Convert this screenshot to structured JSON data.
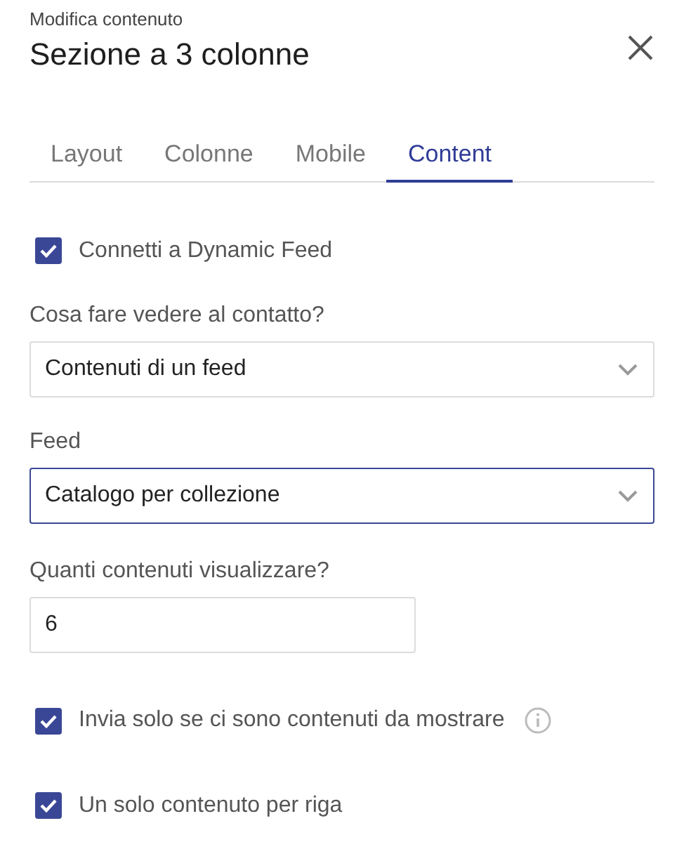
{
  "header": {
    "subtitle": "Modifica contenuto",
    "title": "Sezione a 3 colonne"
  },
  "tabs": [
    {
      "label": "Layout",
      "selected": false
    },
    {
      "label": "Colonne",
      "selected": false
    },
    {
      "label": "Mobile",
      "selected": false
    },
    {
      "label": "Content",
      "selected": true
    }
  ],
  "fields": [
    {
      "kind": "checkbox",
      "label": "Connetti a Dynamic Feed",
      "checked": true,
      "info": false
    },
    {
      "kind": "select",
      "label": "Cosa fare vedere al contatto?",
      "value": "Contenuti di un feed",
      "focused": false
    },
    {
      "kind": "select",
      "label": "Feed",
      "value": "Catalogo per collezione",
      "focused": true
    },
    {
      "kind": "input",
      "label": "Quanti contenuti visualizzare?",
      "value": "6"
    },
    {
      "kind": "checkbox",
      "label": "Invia solo se ci sono contenuti da mostrare",
      "checked": true,
      "info": true
    },
    {
      "kind": "checkbox",
      "label": "Un solo contenuto per riga",
      "checked": true,
      "info": false
    }
  ]
}
